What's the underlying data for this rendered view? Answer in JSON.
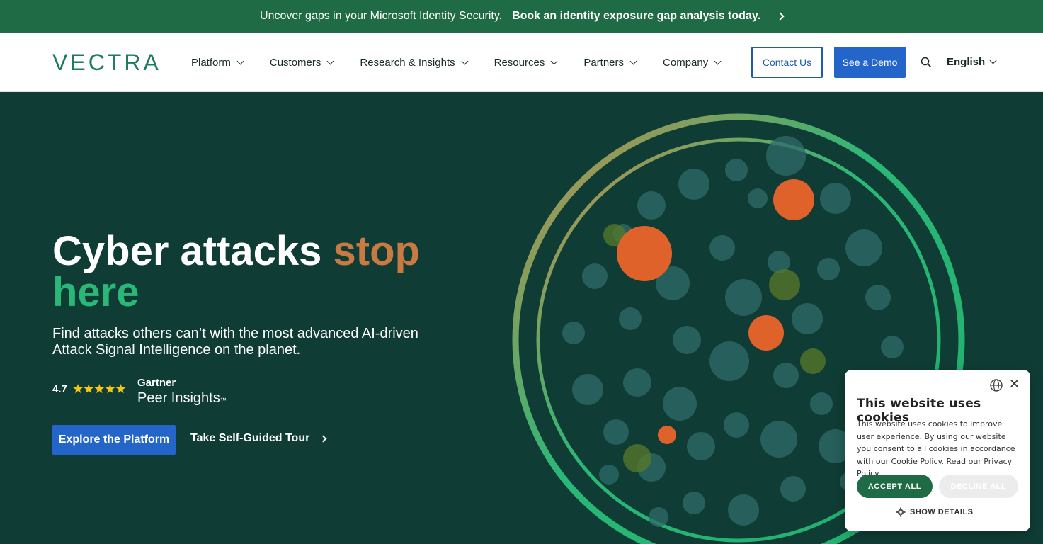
{
  "banner": {
    "text": "Uncover gaps in your Microsoft Identity Security.",
    "link_text": "Book an identity exposure gap analysis today."
  },
  "header": {
    "logo": "VECTRA",
    "nav": [
      {
        "label": "Platform"
      },
      {
        "label": "Customers"
      },
      {
        "label": "Research & Insights"
      },
      {
        "label": "Resources"
      },
      {
        "label": "Partners"
      },
      {
        "label": "Company"
      }
    ],
    "contact_label": "Contact Us",
    "demo_label": "See a Demo",
    "language": "English"
  },
  "hero": {
    "title_part1": "Cyber attacks ",
    "title_part2": "stop",
    "title_part3": "here",
    "subtitle": "Find attacks others can’t with the most advanced AI-driven Attack Signal Intelligence on the planet.",
    "rating": "4.7",
    "stars": "★★★★★",
    "gartner_line1": "Gartner",
    "gartner_line2": "Peer Insights",
    "gartner_tm": "™",
    "explore_label": "Explore the Platform",
    "tour_label": "Take Self-Guided Tour"
  },
  "cookie": {
    "title": "This website uses cookies",
    "body": "This website uses cookies to improve user experience. By using our website you consent to all cookies in accordance with our Cookie Policy. Read our Privacy Policy.",
    "accept_label": "ACCEPT ALL",
    "decline_label": "DECLINE ALL",
    "details_label": "SHOW DETAILS"
  },
  "colors": {
    "banner_bg": "#1f6b45",
    "hero_bg": "#0f3d35",
    "brand_green": "#1d7b63",
    "accent_blue": "#2465c9",
    "title_orange": "#c97a42",
    "title_green": "#2ab878",
    "dot_orange": "#e0622b"
  }
}
